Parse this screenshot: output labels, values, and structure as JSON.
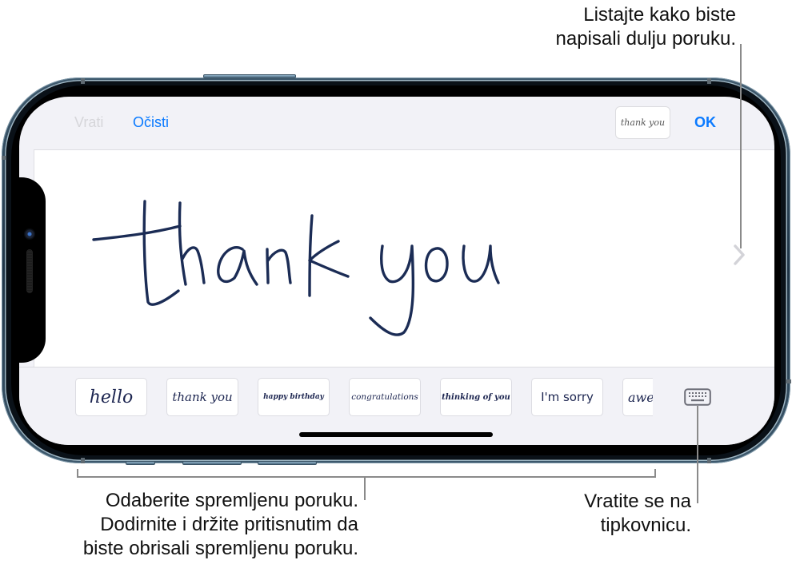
{
  "toolbar": {
    "undo_label": "Vrati",
    "clear_label": "Očisti",
    "preview_label": "thank you",
    "ok_label": "OK"
  },
  "canvas": {
    "handwritten_text": "thank you",
    "ink_color": "#1b2c55",
    "scroll_icon": "chevron-right-icon"
  },
  "saved_messages": [
    {
      "label": "hello"
    },
    {
      "label": "thank you"
    },
    {
      "label": "happy birthday"
    },
    {
      "label": "congratulations"
    },
    {
      "label": "thinking of you"
    },
    {
      "label": "I'm sorry"
    },
    {
      "label": "awe"
    }
  ],
  "keyboard_button": {
    "icon": "keyboard-icon"
  },
  "accent_color": "#0a7aff",
  "callouts": {
    "scroll": {
      "line1": "Listajte kako biste",
      "line2": "napisali dulju poruku."
    },
    "saved": {
      "line1": "Odaberite spremljenu poruku.",
      "line2": "Dodirnite i držite pritisnutim da",
      "line3": "biste obrisali spremljenu poruku."
    },
    "keyboard": {
      "line1": "Vratite se na",
      "line2": "tipkovnicu."
    }
  }
}
